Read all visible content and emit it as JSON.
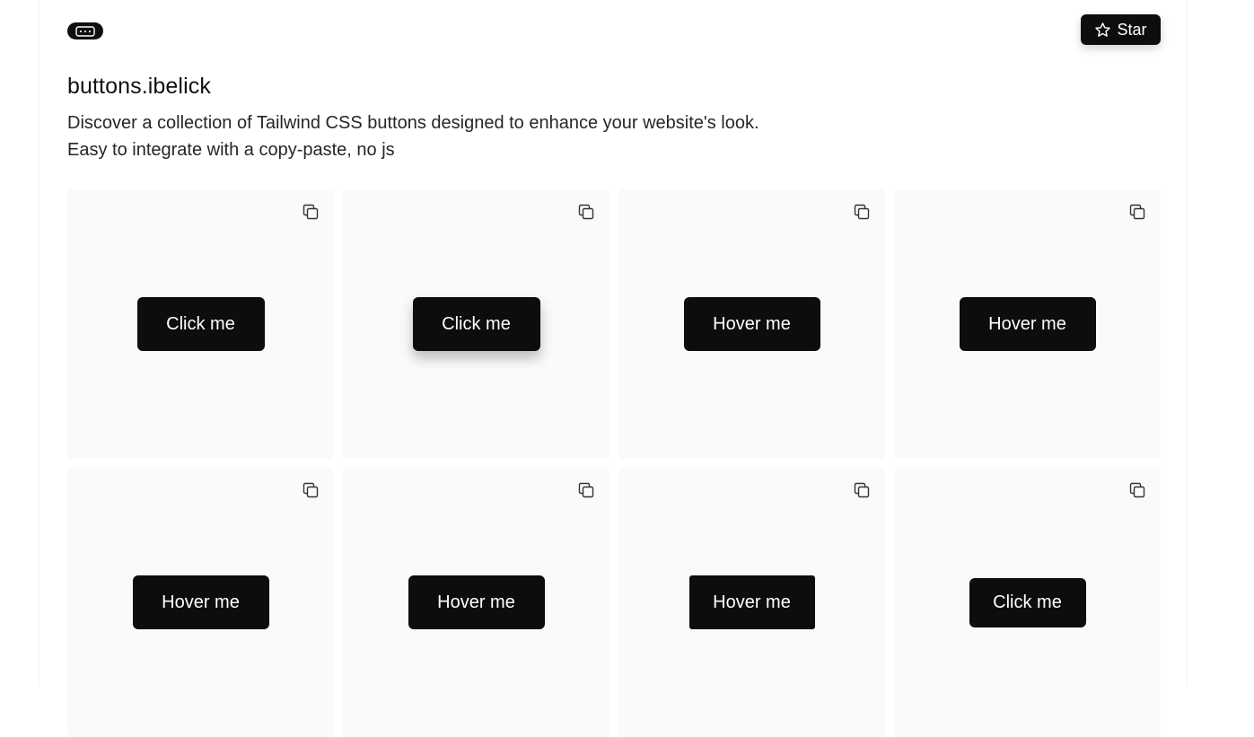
{
  "header": {
    "logo_icon": "keyboard-icon",
    "star_label": "Star",
    "star_icon": "star-icon"
  },
  "hero": {
    "title": "buttons.ibelick",
    "description_line1": "Discover a collection of Tailwind CSS buttons designed to enhance your website's look.",
    "description_line2": "Easy to integrate with a copy-paste, no js"
  },
  "cards": [
    {
      "label": "Click me",
      "copy_icon": "copy-icon"
    },
    {
      "label": "Click me",
      "copy_icon": "copy-icon"
    },
    {
      "label": "Hover me",
      "copy_icon": "copy-icon"
    },
    {
      "label": "Hover me",
      "copy_icon": "copy-icon"
    },
    {
      "label": "Hover me",
      "copy_icon": "copy-icon"
    },
    {
      "label": "Hover me",
      "copy_icon": "copy-icon"
    },
    {
      "label": "Hover me",
      "copy_icon": "copy-icon"
    },
    {
      "label": "Click me",
      "copy_icon": "copy-icon"
    }
  ],
  "colors": {
    "button_bg": "#0d0d0d",
    "card_bg": "#fafafa",
    "text": "#171717"
  }
}
